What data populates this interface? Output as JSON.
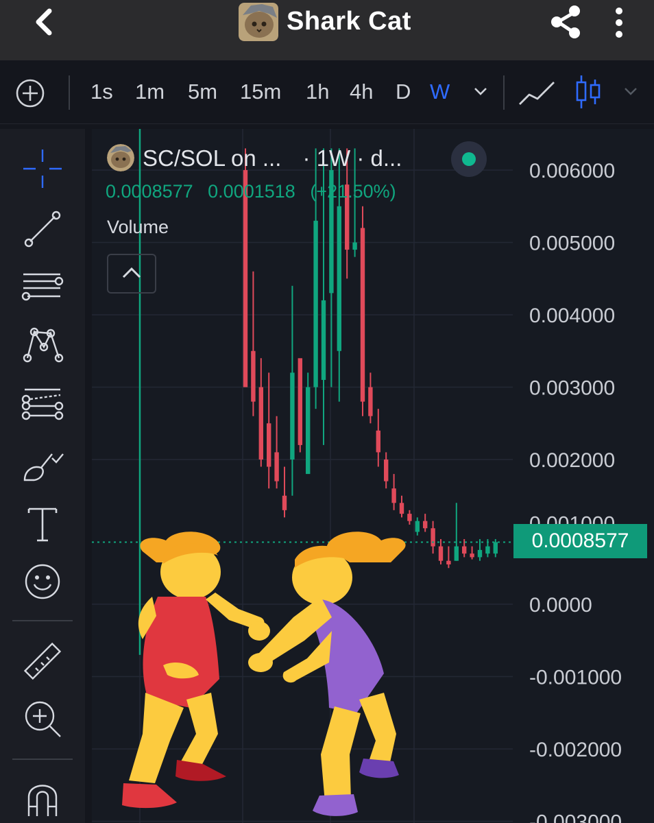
{
  "header": {
    "back_icon": "chevron-left-icon",
    "coin_name": "Shark Cat",
    "share_icon": "share-icon",
    "more_icon": "more-vertical-icon"
  },
  "timeframes": {
    "add_icon": "plus-circle-icon",
    "items": [
      "1s",
      "1m",
      "5m",
      "15m",
      "1h",
      "4h",
      "D",
      "W"
    ],
    "active": "W",
    "accent_color": "#2f6bff"
  },
  "chart_type_icons": [
    "line-chart-icon",
    "candlestick-icon"
  ],
  "drawing_tools": [
    "crosshair-icon",
    "trend-line-icon",
    "horizontal-lines-icon",
    "pattern-icon",
    "fib-retracement-icon",
    "brush-icon",
    "text-icon",
    "emoji-icon",
    "ruler-icon",
    "zoom-in-icon",
    "magnet-icon"
  ],
  "legend": {
    "pair": "SC/SOL on ...",
    "interval": "· 1W · d...",
    "close": "0.0008577",
    "change": "0.0001518",
    "change_pct": "(+21.50%)",
    "volume_label": "Volume",
    "up_color": "#10a67f",
    "down_color": "#e04a5a"
  },
  "price_axis": {
    "ticks": [
      "0.006000",
      "0.005000",
      "0.004000",
      "0.003000",
      "0.002000",
      "0.0000",
      "-0.001000",
      "-0.002000",
      "-0.003000"
    ],
    "hidden_tick": "0.001000",
    "current_price": "0.0008577"
  },
  "chart_data": {
    "type": "candlestick",
    "ylim": [
      -0.003,
      0.0063
    ],
    "current_price": 0.0008577,
    "candles": [
      {
        "o": 0.006,
        "h": 0.0063,
        "l": 0.003,
        "c": 0.003
      },
      {
        "o": 0.0035,
        "h": 0.0046,
        "l": 0.0026,
        "c": 0.0028
      },
      {
        "o": 0.003,
        "h": 0.0034,
        "l": 0.0019,
        "c": 0.002
      },
      {
        "o": 0.0025,
        "h": 0.0032,
        "l": 0.0016,
        "c": 0.0019
      },
      {
        "o": 0.0021,
        "h": 0.0026,
        "l": 0.0016,
        "c": 0.0017
      },
      {
        "o": 0.0015,
        "h": 0.0019,
        "l": 0.0012,
        "c": 0.0013
      },
      {
        "o": 0.002,
        "h": 0.0044,
        "l": 0.0015,
        "c": 0.0032
      },
      {
        "o": 0.0034,
        "h": 0.0031,
        "l": 0.0021,
        "c": 0.0022
      },
      {
        "o": 0.0018,
        "h": 0.0032,
        "l": 0.0019,
        "c": 0.003
      },
      {
        "o": 0.003,
        "h": 0.0063,
        "l": 0.0027,
        "c": 0.0053
      },
      {
        "o": 0.0031,
        "h": 0.0063,
        "l": 0.0022,
        "c": 0.0042
      },
      {
        "o": 0.0043,
        "h": 0.0063,
        "l": 0.003,
        "c": 0.006
      },
      {
        "o": 0.0035,
        "h": 0.0063,
        "l": 0.0028,
        "c": 0.0055
      },
      {
        "o": 0.0058,
        "h": 0.0063,
        "l": 0.0045,
        "c": 0.0049
      },
      {
        "o": 0.0049,
        "h": 0.0063,
        "l": 0.0048,
        "c": 0.005
      },
      {
        "o": 0.0052,
        "h": 0.0055,
        "l": 0.0026,
        "c": 0.0028
      },
      {
        "o": 0.003,
        "h": 0.0032,
        "l": 0.0025,
        "c": 0.0026
      },
      {
        "o": 0.0024,
        "h": 0.0027,
        "l": 0.0019,
        "c": 0.0021
      },
      {
        "o": 0.002,
        "h": 0.0021,
        "l": 0.0016,
        "c": 0.0017
      },
      {
        "o": 0.0016,
        "h": 0.0018,
        "l": 0.0013,
        "c": 0.0014
      },
      {
        "o": 0.0014,
        "h": 0.0015,
        "l": 0.0012,
        "c": 0.00125
      },
      {
        "o": 0.00125,
        "h": 0.0013,
        "l": 0.0011,
        "c": 0.00115
      },
      {
        "o": 0.001,
        "h": 0.0012,
        "l": 0.00095,
        "c": 0.00115
      },
      {
        "o": 0.00115,
        "h": 0.00125,
        "l": 0.001,
        "c": 0.00105
      },
      {
        "o": 0.00105,
        "h": 0.00115,
        "l": 0.0007,
        "c": 0.0008
      },
      {
        "o": 0.0008,
        "h": 0.0009,
        "l": 0.00055,
        "c": 0.0006
      },
      {
        "o": 0.0006,
        "h": 0.0008,
        "l": 0.0005,
        "c": 0.00055
      },
      {
        "o": 0.0006,
        "h": 0.0014,
        "l": 0.0006,
        "c": 0.0008
      },
      {
        "o": 0.0008,
        "h": 0.0009,
        "l": 0.00065,
        "c": 0.0007
      },
      {
        "o": 0.0007,
        "h": 0.0008,
        "l": 0.00062,
        "c": 0.00065
      },
      {
        "o": 0.00065,
        "h": 0.0009,
        "l": 0.0006,
        "c": 0.00075
      },
      {
        "o": 0.0007,
        "h": 0.0009,
        "l": 0.00065,
        "c": 0.0008
      },
      {
        "o": 0.0007,
        "h": 0.0009,
        "l": 0.00065,
        "c": 0.0008577
      }
    ]
  }
}
